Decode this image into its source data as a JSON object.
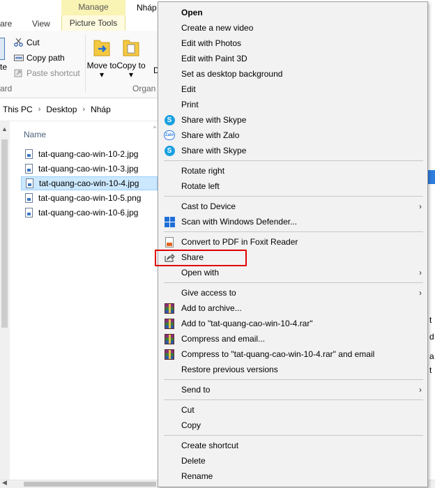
{
  "explorer": {
    "tabs": {
      "share_fragment": "are",
      "view": "View",
      "manage": "Manage",
      "picture_tools": "Picture Tools"
    },
    "title_fragment": "Nháp",
    "ribbon": {
      "cut": "Cut",
      "copy_path": "Copy path",
      "paste_shortcut": "Paste shortcut",
      "move_to": "Move to ▾",
      "copy_to": "Copy to ▾",
      "clipboard_fragment": "ard",
      "organize_fragment": "Organ",
      "left_fragment": "te",
      "delete_fragment": "D"
    },
    "breadcrumb": [
      "This PC",
      "Desktop",
      "Nháp"
    ],
    "column_header": "Name",
    "files": [
      "tat-quang-cao-win-10-2.jpg",
      "tat-quang-cao-win-10-3.jpg",
      "tat-quang-cao-win-10-4.jpg",
      "tat-quang-cao-win-10-5.png",
      "tat-quang-cao-win-10-6.jpg"
    ],
    "selected_file_index": 2,
    "right_edge_fragments": [
      "t",
      "d",
      "a",
      "t"
    ]
  },
  "context_menu": {
    "open": "Open",
    "create_video": "Create a new video",
    "edit_photos": "Edit with Photos",
    "edit_paint3d": "Edit with Paint 3D",
    "set_background": "Set as desktop background",
    "edit": "Edit",
    "print": "Print",
    "share_skype_1": "Share with Skype",
    "share_zalo": "Share with Zalo",
    "share_skype_2": "Share with Skype",
    "rotate_right": "Rotate right",
    "rotate_left": "Rotate left",
    "cast_to_device": "Cast to Device",
    "scan_defender": "Scan with Windows Defender...",
    "convert_pdf": "Convert to PDF in Foxit Reader",
    "share": "Share",
    "open_with": "Open with",
    "give_access": "Give access to",
    "add_archive": "Add to archive...",
    "add_rar": "Add to \"tat-quang-cao-win-10-4.rar\"",
    "compress_email": "Compress and email...",
    "compress_rar_email": "Compress to \"tat-quang-cao-win-10-4.rar\" and email",
    "restore_versions": "Restore previous versions",
    "send_to": "Send to",
    "cut": "Cut",
    "copy": "Copy",
    "create_shortcut": "Create shortcut",
    "delete": "Delete",
    "rename": "Rename"
  },
  "icons": {
    "skype": "S",
    "zalo": "Zalo",
    "submenu_arrow": "›",
    "breadcrumb_sep": "›"
  },
  "colors": {
    "manage_tab": "#f9f3b4",
    "selection": "#cce8ff",
    "highlight_box": "#e00000",
    "skype": "#18a0e0",
    "menu_bg": "#f2f2f2"
  }
}
